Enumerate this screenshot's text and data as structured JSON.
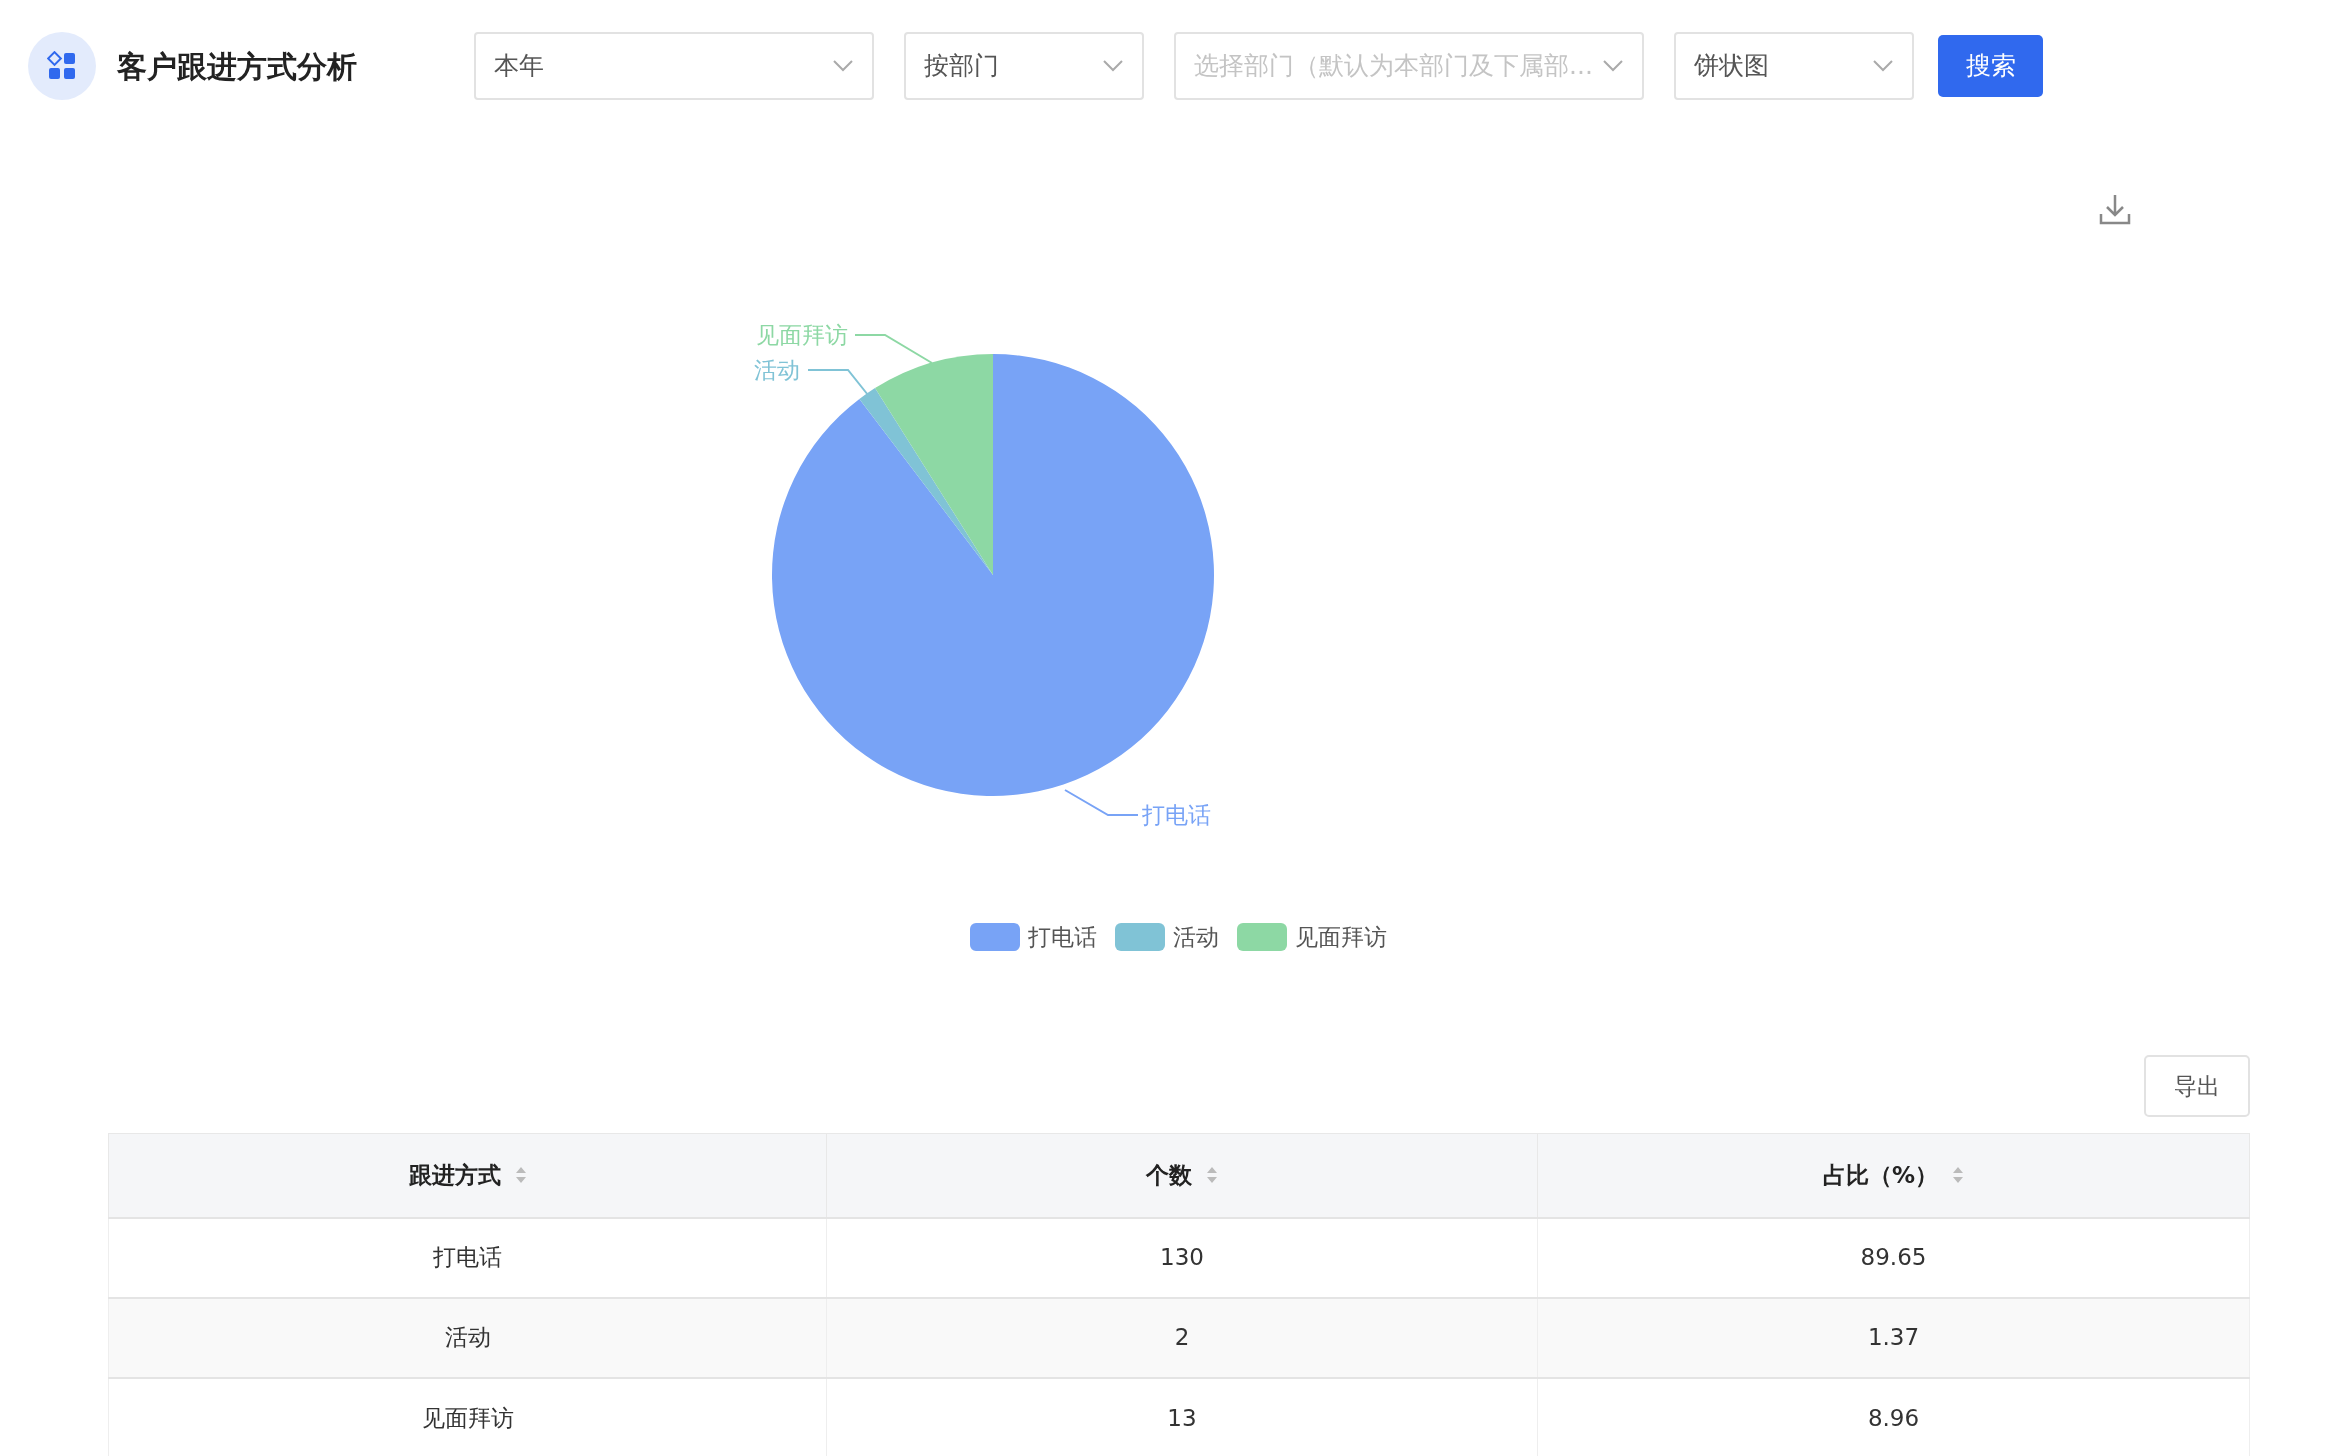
{
  "header": {
    "title": "客户跟进方式分析"
  },
  "filters": [
    {
      "kind": "select",
      "value": "本年"
    },
    {
      "kind": "select",
      "value": "按部门"
    },
    {
      "kind": "select",
      "placeholder": "选择部门（默认为本部门及下属部..."
    },
    {
      "kind": "select",
      "value": "饼状图"
    }
  ],
  "search_button": "搜索",
  "chart": {
    "chart_data": {
      "type": "pie",
      "categories": [
        "打电话",
        "活动",
        "见面拜访"
      ],
      "values": [
        89.65,
        1.37,
        8.96
      ],
      "colors": [
        "#78a3f6",
        "#80c3d6",
        "#8dd8a4"
      ],
      "legend": "bottom"
    }
  },
  "export_button": "导出",
  "table": {
    "columns": [
      "跟进方式",
      "个数",
      "占比（%）"
    ],
    "rows": [
      [
        "打电话",
        "130",
        "89.65"
      ],
      [
        "活动",
        "2",
        "1.37"
      ],
      [
        "见面拜访",
        "13",
        "8.96"
      ]
    ]
  }
}
